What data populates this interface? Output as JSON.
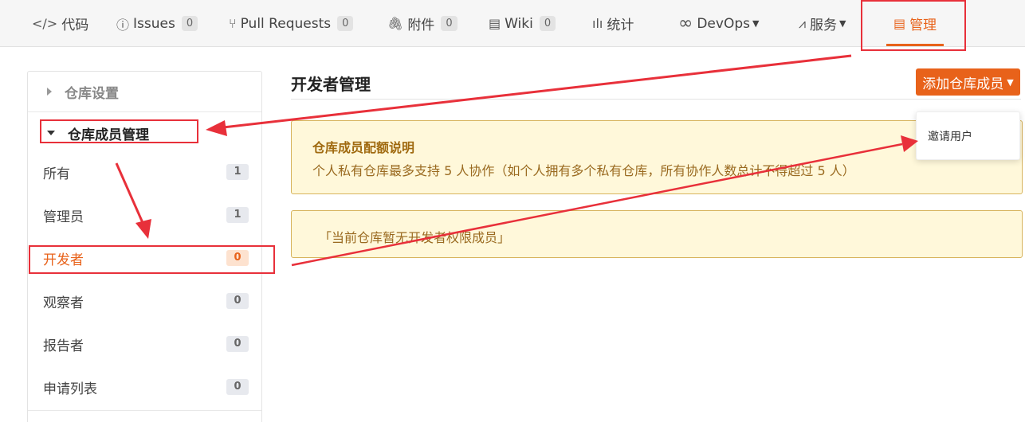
{
  "nav": {
    "tabs": [
      {
        "label": "代码",
        "icon": "code-icon",
        "glyph": "</>"
      },
      {
        "label": "Issues",
        "icon": "issue-icon",
        "glyph": "ⓘ",
        "count": "0"
      },
      {
        "label": "Pull Requests",
        "icon": "pull-request-icon",
        "glyph": "⑂",
        "count": "0"
      },
      {
        "label": "附件",
        "icon": "paperclip-icon",
        "glyph": "🖇",
        "count": "0"
      },
      {
        "label": "Wiki",
        "icon": "book-icon",
        "glyph": "▤",
        "count": "0"
      },
      {
        "label": "统计",
        "icon": "bar-chart-icon",
        "glyph": "ılı"
      },
      {
        "label": "DevOps",
        "icon": "infinity-icon",
        "glyph": "∞"
      },
      {
        "label": "服务",
        "icon": "pulse-icon",
        "glyph": "⩘"
      },
      {
        "label": "管理",
        "icon": "manage-icon",
        "glyph": "▤"
      }
    ],
    "active_tab": "管理"
  },
  "sidebar": {
    "sections": [
      {
        "label": "仓库设置",
        "expanded": false
      },
      {
        "label": "仓库成员管理",
        "expanded": true
      }
    ],
    "items": [
      {
        "label": "所有",
        "count": "1"
      },
      {
        "label": "管理员",
        "count": "1"
      },
      {
        "label": "开发者",
        "count": "0"
      },
      {
        "label": "观察者",
        "count": "0"
      },
      {
        "label": "报告者",
        "count": "0"
      },
      {
        "label": "申请列表",
        "count": "0"
      }
    ],
    "active_item": "开发者"
  },
  "main": {
    "title": "开发者管理",
    "add_button": "添加仓库成员",
    "dropdown": {
      "options": [
        "邀请用户"
      ]
    },
    "quota_notice": {
      "heading": "仓库成员配额说明",
      "body": "个人私有仓库最多支持 5 人协作（如个人拥有多个私有仓库，所有协作人数总计不得超过 5 人）"
    },
    "empty_notice": "「当前仓库暂无开发者权限成员」"
  },
  "colors": {
    "accent": "#e8621a",
    "annotation_red": "#e8303a",
    "notice_bg": "#fff8da",
    "notice_border": "#d8b45d"
  }
}
